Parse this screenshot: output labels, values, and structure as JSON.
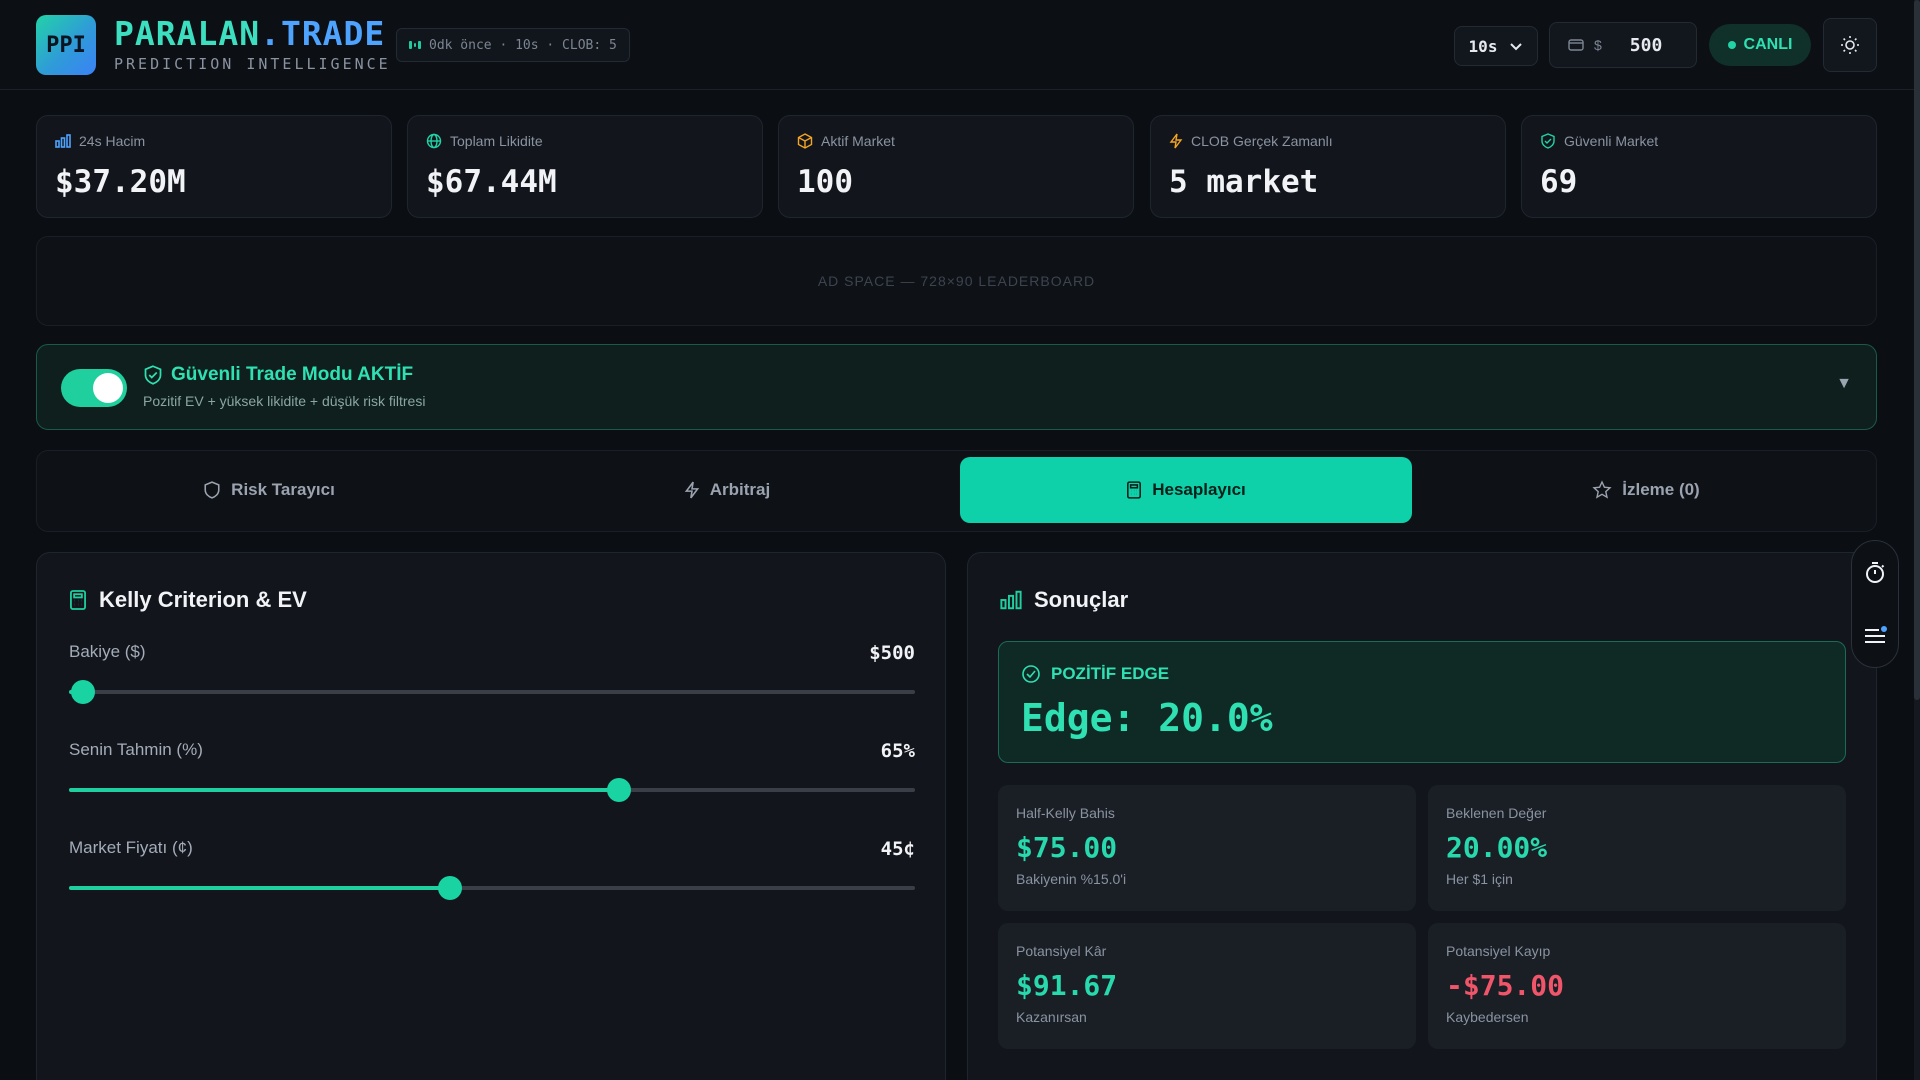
{
  "header": {
    "logo_text": "PPI",
    "brand_part1": "PARALAN",
    "brand_part2": ".TRADE",
    "brand_sub": "PREDICTION INTELLIGENCE",
    "status": "0dk önce · 10s · CLOB: 5",
    "interval": "10s",
    "balance_currency": "$",
    "balance_value": "500",
    "live_label": "CANLI"
  },
  "stats": [
    {
      "label": "24s Hacim",
      "value": "$37.20M",
      "icon": "bar-chart-icon"
    },
    {
      "label": "Toplam Likidite",
      "value": "$67.44M",
      "icon": "globe-icon"
    },
    {
      "label": "Aktif Market",
      "value": "100",
      "icon": "box-icon"
    },
    {
      "label": "CLOB Gerçek Zamanlı",
      "value": "5 market",
      "icon": "lightning-icon"
    },
    {
      "label": "Güvenli Market",
      "value": "69",
      "icon": "shield-check-icon"
    }
  ],
  "ad": {
    "text": "AD SPACE — 728×90 LEADERBOARD"
  },
  "safe_mode": {
    "title": "Güvenli Trade Modu AKTİF",
    "subtitle": "Pozitif EV + yüksek likidite + düşük risk filtresi",
    "enabled": true
  },
  "tabs": [
    {
      "label": "Risk Tarayıcı",
      "icon": "shield-icon",
      "active": false
    },
    {
      "label": "Arbitraj",
      "icon": "lightning-icon",
      "active": false
    },
    {
      "label": "Hesaplayıcı",
      "icon": "calculator-icon",
      "active": true
    },
    {
      "label": "İzleme (0)",
      "icon": "star-icon",
      "active": false
    }
  ],
  "kelly": {
    "title": "Kelly Criterion & EV",
    "sliders": [
      {
        "label": "Bakiye ($)",
        "value": "$500",
        "fraction": 0.017
      },
      {
        "label": "Senin Tahmin (%)",
        "value": "65%",
        "fraction": 0.65
      },
      {
        "label": "Market Fiyatı (¢)",
        "value": "45¢",
        "fraction": 0.45
      }
    ]
  },
  "results": {
    "title": "Sonuçlar",
    "edge_label": "POZİTİF EDGE",
    "edge_value": "Edge: 20.0%",
    "cards": [
      {
        "label": "Half-Kelly Bahis",
        "value": "$75.00",
        "sub": "Bakiyenin %15.0'i",
        "negative": false
      },
      {
        "label": "Beklenen Değer",
        "value": "20.00%",
        "sub": "Her $1 için",
        "negative": false
      },
      {
        "label": "Potansiyel Kâr",
        "value": "$91.67",
        "sub": "Kazanırsan",
        "negative": false
      },
      {
        "label": "Potansiyel Kayıp",
        "value": "-$75.00",
        "sub": "Kaybedersen",
        "negative": true
      }
    ]
  },
  "colors": {
    "accent": "#0fd1a9",
    "brand_blue": "#4ea3ff",
    "negative": "#f0556a"
  }
}
